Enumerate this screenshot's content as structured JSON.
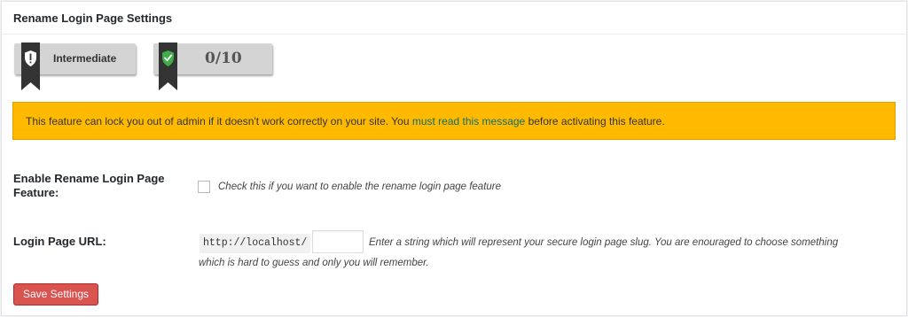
{
  "panel": {
    "title": "Rename Login Page Settings"
  },
  "badges": {
    "level": {
      "label": "Intermediate"
    },
    "score": {
      "label": "0/10"
    }
  },
  "colors": {
    "warning_background": "#ffba00",
    "link": "#0f6c6e",
    "save_button": "#d9534f",
    "badge_background": "#d4d4d4",
    "ribbon": "#333333",
    "shield_green": "#3fae49"
  },
  "icons": {
    "level_badge": "warning-shield-icon",
    "score_badge": "check-shield-icon"
  },
  "warning": {
    "text_before": "This feature can lock you out of admin if it doesn't work correctly on your site. You ",
    "link_text": "must read this message",
    "text_after": " before activating this feature."
  },
  "enable_field": {
    "label_line1": "Enable Rename Login Page",
    "label_line2": "Feature:",
    "checked": false,
    "hint": "Check this if you want to enable the rename login page feature"
  },
  "url_field": {
    "label": "Login Page URL:",
    "prefix": "http://localhost/",
    "value": "",
    "hint_line1": "Enter a string which will represent your secure login page slug. You are enouraged to choose something",
    "hint_line2": "which is hard to guess and only you will remember."
  },
  "save_button_label": "Save Settings"
}
